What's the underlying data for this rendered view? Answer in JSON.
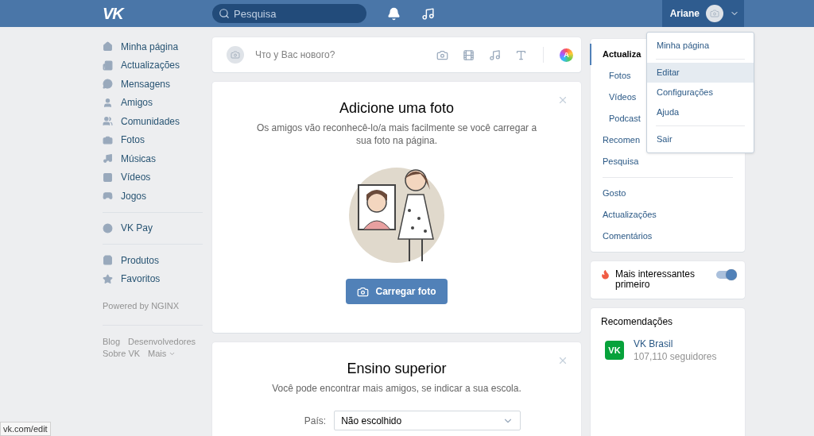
{
  "header": {
    "logo": "VK",
    "search": {
      "placeholder": "Pesquisa"
    },
    "user": {
      "name": "Ariane"
    }
  },
  "sidebar": {
    "groups": [
      {
        "items": [
          {
            "label": "Minha página"
          },
          {
            "label": "Actualizações"
          },
          {
            "label": "Mensagens"
          },
          {
            "label": "Amigos"
          },
          {
            "label": "Comunidades"
          },
          {
            "label": "Fotos"
          },
          {
            "label": "Músicas"
          },
          {
            "label": "Vídeos"
          },
          {
            "label": "Jogos"
          }
        ]
      },
      {
        "items": [
          {
            "label": "VK Pay"
          }
        ]
      },
      {
        "items": [
          {
            "label": "Produtos"
          },
          {
            "label": "Favoritos"
          }
        ]
      }
    ],
    "powered": "Powered by NGINX",
    "footer_links": [
      "Blog",
      "Desenvolvedores",
      "Sobre VK",
      "Mais"
    ]
  },
  "composer": {
    "placeholder": "Что у Вас нового?",
    "avatar_letter": "A"
  },
  "photo_card": {
    "title": "Adicione uma foto",
    "text": "Os amigos vão reconhecê-lo/a mais facilmente se você carregar a sua foto na página.",
    "button": "Carregar foto"
  },
  "school_card": {
    "title": "Ensino superior",
    "text": "Você pode encontrar mais amigos, se indicar a sua escola.",
    "field_label": "País:",
    "field_value": "Não escolhido"
  },
  "news_menu": {
    "groups": [
      {
        "items": [
          {
            "label": "Actualiza",
            "selected": true,
            "children": [
              {
                "label": "Fotos",
                "selected": false
              },
              {
                "label": "Vídeos",
                "selected": false
              },
              {
                "label": "Podcast",
                "selected": false
              }
            ]
          },
          {
            "label": "Recomen",
            "selected": false
          },
          {
            "label": "Pesquisa",
            "selected": false
          }
        ]
      },
      {
        "items": [
          {
            "label": "Gosto",
            "selected": false
          },
          {
            "label": "Actualizações",
            "selected": false
          },
          {
            "label": "Comentários",
            "selected": false
          }
        ]
      }
    ]
  },
  "smart_feed": {
    "label": "Mais interessantes primeiro",
    "on": true
  },
  "recommendations": {
    "title": "Recomendações",
    "items": [
      {
        "name": "VK Brasil",
        "logo": "VK",
        "followers": "107,110 seguidores"
      }
    ]
  },
  "user_menu": {
    "groups": [
      {
        "items": [
          {
            "label": "Minha página",
            "selected": false
          }
        ]
      },
      {
        "items": [
          {
            "label": "Editar",
            "selected": true
          },
          {
            "label": "Configurações",
            "selected": false
          },
          {
            "label": "Ajuda",
            "selected": false
          }
        ]
      },
      {
        "items": [
          {
            "label": "Sair",
            "selected": false
          }
        ]
      }
    ]
  },
  "status_bar": {
    "url": "vk.com/edit"
  }
}
